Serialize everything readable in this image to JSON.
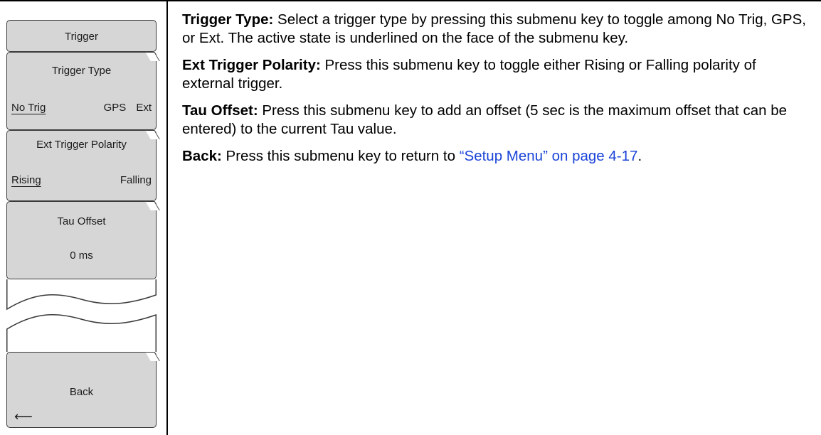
{
  "menu": {
    "title": "Trigger",
    "keys": [
      {
        "label": "Trigger Type",
        "options": [
          "No Trig",
          "GPS",
          "Ext"
        ],
        "selected": "No Trig"
      },
      {
        "label": "Ext Trigger Polarity",
        "options": [
          "Rising",
          "Falling"
        ],
        "selected": "Rising"
      },
      {
        "label": "Tau Offset",
        "value": "0 ms"
      }
    ],
    "back_label": "Back",
    "back_arrow": "⟵"
  },
  "descriptions": [
    {
      "term": "Trigger Type:",
      "text": " Select a trigger type by pressing this submenu key to toggle among No Trig, GPS, or Ext. The active state is underlined on the face of the submenu key."
    },
    {
      "term": "Ext Trigger Polarity:",
      "text": " Press this submenu key to toggle either Rising or Falling polarity of external trigger."
    },
    {
      "term": "Tau Offset:",
      "text": " Press this submenu key to add an offset (5 sec is the maximum offset that can be entered) to the current Tau value."
    },
    {
      "term": "Back:",
      "text": " Press this submenu key to return to ",
      "link": "“Setup Menu” on page 4-17",
      "tail": "."
    }
  ],
  "colors": {
    "key_fill": "#d6d6d6",
    "link": "#1a44d8"
  }
}
